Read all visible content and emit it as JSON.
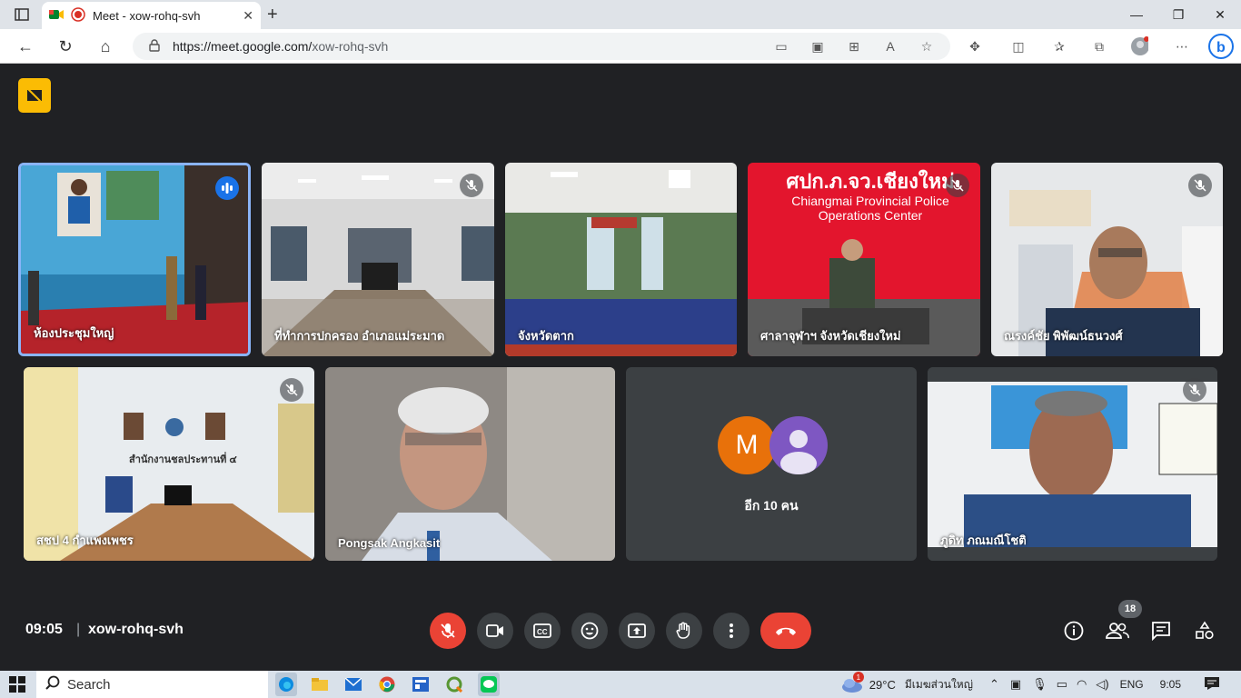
{
  "browser": {
    "tab_title": "Meet - xow-rohq-svh",
    "url_host": "https://meet.google.com/",
    "url_path": "xow-rohq-svh"
  },
  "meeting": {
    "time": "09:05",
    "separator": "|",
    "code": "xow-rohq-svh",
    "participant_count": "18",
    "accent": "#1a73e8",
    "end_call_color": "#ea4335"
  },
  "tiles": [
    {
      "name": "ห้องประชุมใหญ่",
      "status": "speaking"
    },
    {
      "name": "ที่ทำการปกครอง อำเภอแม่ระมาด",
      "status": "muted"
    },
    {
      "name": "จังหวัดตาก",
      "status": "none"
    },
    {
      "name": "ศาลาจุฬาฯ จังหวัดเชียงใหม่",
      "status": "muted",
      "sign_line1": "ศปก.ภ.จว.เชียงใหม่",
      "sign_line2": "Chiangmai Provincial Police",
      "sign_line3": "Operations Center"
    },
    {
      "name": "ณรงค์ชัย พิพัฒน์ธนวงศ์",
      "status": "muted"
    },
    {
      "name": "สชป 4 กำแพงเพชร",
      "status": "muted",
      "wall_text": "สำนักงานชลประทานที่ ๔"
    },
    {
      "name": "Pongsak Angkasit",
      "status": "none"
    },
    {
      "name": "อีก 10 คน",
      "avatar_letter": "M",
      "avatar_color": "#e8710a",
      "avatar2_color": "#7e57c2"
    },
    {
      "name": "ภูดิท ภณมณีโชติ",
      "status": "muted"
    }
  ],
  "taskbar": {
    "search_label": "Search",
    "weather": "29°C",
    "weather_desc": "มีเมฆส่วนใหญ่",
    "lang": "ENG",
    "clock": "9:05",
    "notif_badge": "1"
  }
}
